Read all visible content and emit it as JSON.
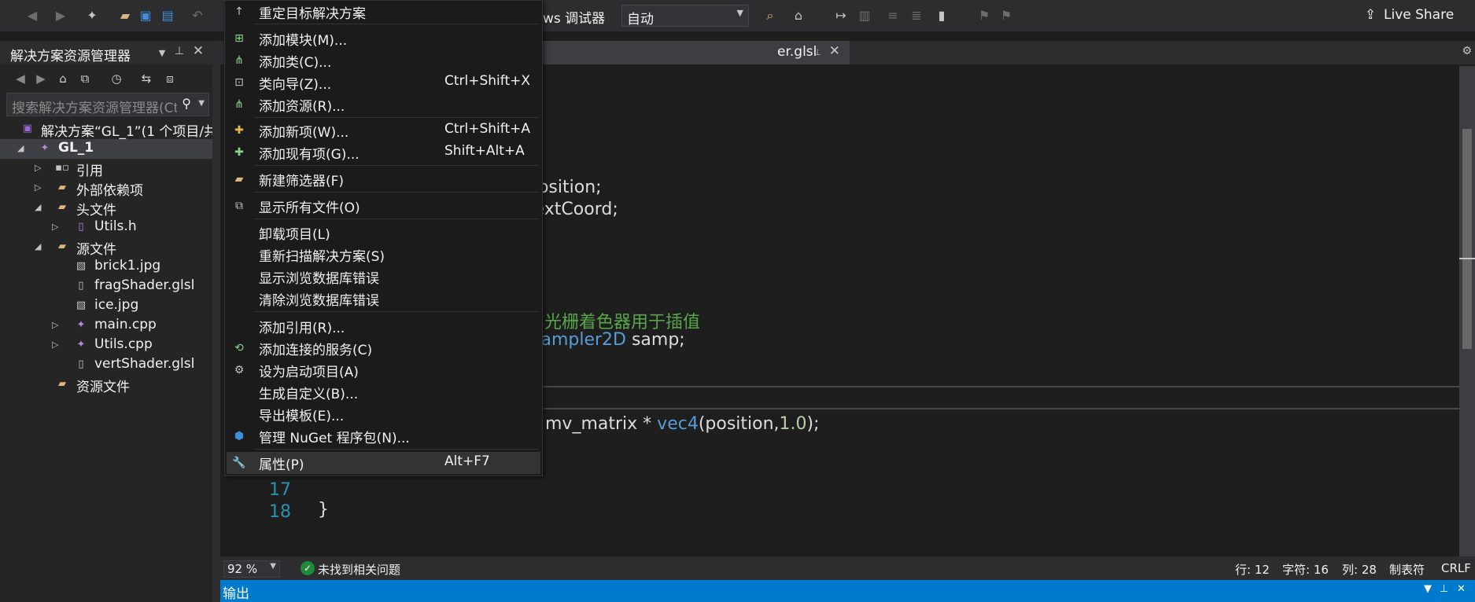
{
  "toolbar": {
    "debugger_label": "ws 调试器",
    "config_value": "自动",
    "live_share": "Live Share"
  },
  "solution_explorer": {
    "title": "解决方案资源管理器",
    "search_placeholder": "搜索解决方案资源管理器(Ct",
    "tree": [
      {
        "label": "解决方案“GL_1”(1 个项目/共",
        "icon": "solution-icon"
      },
      {
        "label": "GL_1",
        "icon": "project-icon"
      },
      {
        "label": "引用",
        "icon": "references-icon"
      },
      {
        "label": "外部依赖项",
        "icon": "external-deps-icon"
      },
      {
        "label": "头文件",
        "icon": "folder-icon"
      },
      {
        "label": "Utils.h",
        "icon": "header-file-icon"
      },
      {
        "label": "源文件",
        "icon": "folder-icon"
      },
      {
        "label": "brick1.jpg",
        "icon": "image-file-icon"
      },
      {
        "label": "fragShader.glsl",
        "icon": "file-icon"
      },
      {
        "label": "ice.jpg",
        "icon": "image-file-icon"
      },
      {
        "label": "main.cpp",
        "icon": "cpp-file-icon"
      },
      {
        "label": "Utils.cpp",
        "icon": "cpp-file-icon"
      },
      {
        "label": "vertShader.glsl",
        "icon": "file-icon"
      },
      {
        "label": "资源文件",
        "icon": "folder-icon"
      }
    ]
  },
  "editor": {
    "tab_label": "er.glsl",
    "code_lines": [
      {
        "n": "",
        "parts": [
          {
            "t": "position;",
            "c": ""
          }
        ]
      },
      {
        "n": "",
        "parts": [
          {
            "t": "textCoord;",
            "c": ""
          }
        ]
      },
      {
        "n": "",
        "parts": [
          {
            "t": "到光栅着色器用于插值",
            "c": "cm"
          }
        ]
      },
      {
        "n": "",
        "parts": [
          {
            "t": "sampler2D",
            "c": "kw"
          },
          {
            "t": " samp;",
            "c": ""
          }
        ]
      },
      {
        "n": "",
        "parts": [
          {
            "t": "x * mv_matrix * ",
            "c": ""
          },
          {
            "t": "vec4",
            "c": "kw"
          },
          {
            "t": "(position,",
            "c": ""
          },
          {
            "t": "1.0",
            "c": "num"
          },
          {
            "t": ");",
            "c": ""
          }
        ]
      },
      {
        "n": "17",
        "parts": [
          {
            "t": "}",
            "c": ""
          }
        ]
      },
      {
        "n": "18",
        "parts": [
          {
            "t": "",
            "c": ""
          }
        ]
      }
    ]
  },
  "statusbar": {
    "zoom": "92 %",
    "issues": "未找到相关问题",
    "line": "行: 12",
    "char": "字符: 16",
    "col": "列: 28",
    "tabs": "制表符",
    "eol": "CRLF"
  },
  "output_panel": {
    "title": "输出"
  },
  "context_menu": {
    "items": [
      {
        "label": "重定目标解决方案",
        "shortcut": "",
        "icon": "arrow-up-icon"
      },
      {
        "label": "添加模块(M)...",
        "shortcut": "",
        "icon": "add-module-icon"
      },
      {
        "label": "添加类(C)...",
        "shortcut": "",
        "icon": "add-class-icon"
      },
      {
        "label": "类向导(Z)...",
        "shortcut": "Ctrl+Shift+X",
        "icon": "class-wizard-icon"
      },
      {
        "label": "添加资源(R)...",
        "shortcut": "",
        "icon": "add-resource-icon"
      },
      {
        "label": "添加新项(W)...",
        "shortcut": "Ctrl+Shift+A",
        "icon": "add-new-item-icon"
      },
      {
        "label": "添加现有项(G)...",
        "shortcut": "Shift+Alt+A",
        "icon": "add-existing-item-icon"
      },
      {
        "label": "新建筛选器(F)",
        "shortcut": "",
        "icon": "new-filter-icon"
      },
      {
        "label": "显示所有文件(O)",
        "shortcut": "",
        "icon": "show-all-files-icon"
      },
      {
        "label": "卸载项目(L)",
        "shortcut": "",
        "icon": ""
      },
      {
        "label": "重新扫描解决方案(S)",
        "shortcut": "",
        "icon": ""
      },
      {
        "label": "显示浏览数据库错误",
        "shortcut": "",
        "icon": ""
      },
      {
        "label": "清除浏览数据库错误",
        "shortcut": "",
        "icon": ""
      },
      {
        "label": "添加引用(R)...",
        "shortcut": "",
        "icon": ""
      },
      {
        "label": "添加连接的服务(C)",
        "shortcut": "",
        "icon": "connected-service-icon"
      },
      {
        "label": "设为启动项目(A)",
        "shortcut": "",
        "icon": "gear-icon"
      },
      {
        "label": "生成自定义(B)...",
        "shortcut": "",
        "icon": ""
      },
      {
        "label": "导出模板(E)...",
        "shortcut": "",
        "icon": ""
      },
      {
        "label": "管理 NuGet 程序包(N)...",
        "shortcut": "",
        "icon": "nuget-icon"
      },
      {
        "label": "属性(P)",
        "shortcut": "Alt+F7",
        "icon": "wrench-icon"
      }
    ]
  }
}
